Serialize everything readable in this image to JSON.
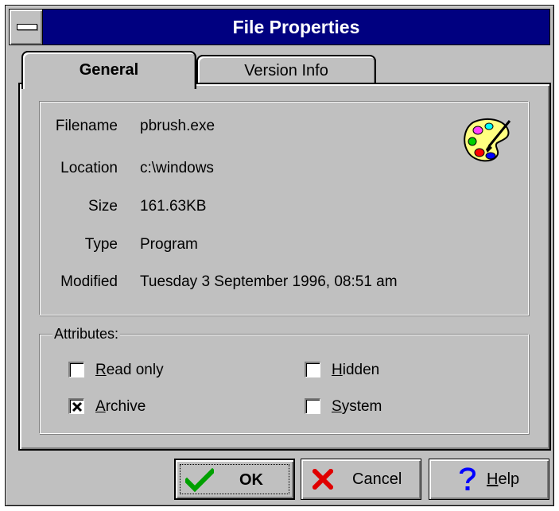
{
  "window": {
    "title": "File Properties"
  },
  "tabs": [
    {
      "label": "General",
      "active": true
    },
    {
      "label": "Version Info",
      "active": false
    }
  ],
  "info": {
    "filename": {
      "label": "Filename",
      "value": "pbrush.exe"
    },
    "location": {
      "label": "Location",
      "value": "c:\\windows"
    },
    "size": {
      "label": "Size",
      "value": "161.63KB"
    },
    "type": {
      "label": "Type",
      "value": "Program"
    },
    "modified": {
      "label": "Modified",
      "value": "Tuesday 3 September 1996,  08:51 am"
    },
    "icon": "paint-palette-icon"
  },
  "attributes": {
    "legend": "Attributes:",
    "read_only": {
      "label_key": "R",
      "label_rest": "ead only",
      "checked": false
    },
    "hidden": {
      "label_key": "H",
      "label_rest": "idden",
      "checked": false
    },
    "archive": {
      "label_key": "A",
      "label_rest": "rchive",
      "checked": true
    },
    "system": {
      "label_key": "S",
      "label_rest": "ystem",
      "checked": false
    }
  },
  "buttons": {
    "ok": {
      "label": "OK",
      "icon": "checkmark-icon"
    },
    "cancel": {
      "label": "Cancel",
      "icon": "x-icon"
    },
    "help": {
      "label_key": "H",
      "label_rest": "elp",
      "icon": "question-mark-icon"
    }
  },
  "colors": {
    "titlebar": "#000080",
    "face": "#c0c0c0",
    "ok_check": "#00a000",
    "cancel_x": "#e00000",
    "help_q": "#0000ff"
  }
}
